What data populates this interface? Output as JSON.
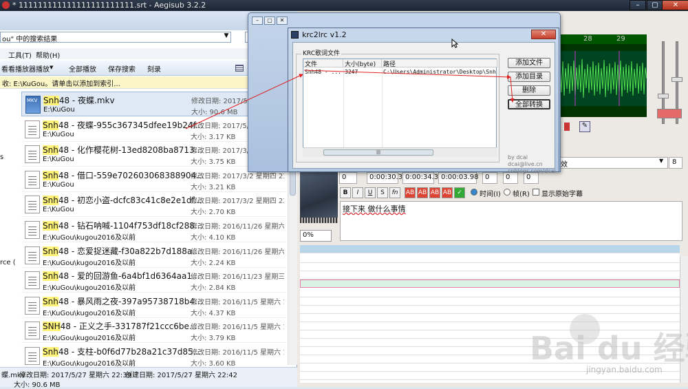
{
  "aegisub": {
    "title": "* 111111111111111111111111.srt - Aegisub 3.2.2",
    "ruler_ticks": [
      "28",
      "29"
    ],
    "time_fields": [
      "0",
      "0:00:30.35",
      "0:00:34.33",
      "0:00:03.98",
      "0",
      "0",
      "0"
    ],
    "format_buttons": [
      "B",
      "I",
      "U",
      "S",
      "fn",
      "AB",
      "AB",
      "AB",
      "AB"
    ],
    "radio_time": "时间(I)",
    "radio_frame": "帧(R)",
    "show_original": "显示原始字幕",
    "edit_text": "接下来 做什么事情",
    "zoom": "0%",
    "style_combo": "效",
    "layer": "8"
  },
  "explorer": {
    "path_text": "ou\" 中的搜索结果",
    "search_value": "snh",
    "menu": [
      "工具(T)",
      "帮助(H)"
    ],
    "toolbar": [
      "看看播放器播放",
      "全部播放",
      "保存搜索",
      "刻录"
    ],
    "info": "收: E:\\KuGou。请单击以添加到索引...",
    "nav_labels": [
      "s",
      "rce ("
    ],
    "files": [
      {
        "pre": "Snh",
        "name": "48 - 夜蝶.mkv",
        "dir": "E:\\KuGou",
        "date": "修改日期: 2017/5/27 星期六 22...",
        "size": "大小: 90.6 MB",
        "video": true
      },
      {
        "pre": "Snh",
        "name": "48 - 夜蝶-955c367345dfee19b24f...",
        "dir": "E:\\KuGou",
        "date": "修改日期: 2017/5/27 星期六 22...",
        "size": "大小: 3.17 KB",
        "video": false
      },
      {
        "pre": "Snh",
        "name": "48 - 化作樱花树-13ed8208ba8713...",
        "dir": "E:\\KuGou",
        "date": "修改日期: 2017/3/2 星期四 23:35",
        "size": "大小: 3.75 KB",
        "video": false
      },
      {
        "pre": "Snh",
        "name": "48 - 借口-559e702603068388904...",
        "dir": "E:\\KuGou",
        "date": "修改日期: 2017/3/2 星期四 23:34",
        "size": "大小: 3.21 KB",
        "video": false
      },
      {
        "pre": "Snh",
        "name": "48 - 初恋小盗-dcfc83c41c8e2e1df...",
        "dir": "E:\\KuGou",
        "date": "修改日期: 2017/3/2 星期四 23:34",
        "size": "大小: 2.70 KB",
        "video": false
      },
      {
        "pre": "Snh",
        "name": "48 - 钻石呐喊-1104f753df18cf288...",
        "dir": "E:\\KuGou\\kugou2016及以前",
        "date": "修改日期: 2016/11/26 星期六 1...",
        "size": "大小: 4.10 KB",
        "video": false
      },
      {
        "pre": "Snh",
        "name": "48 - 恋爱捉迷藏-f30a822b7d188a...",
        "dir": "E:\\KuGou\\kugou2016及以前",
        "date": "修改日期: 2016/11/26 星期六 1...",
        "size": "大小: 2.24 KB",
        "video": false
      },
      {
        "pre": "Snh",
        "name": "48 - 爱的回游鱼-6a4bf1d6364aa1...",
        "dir": "E:\\KuGou\\kugou2016及以前",
        "date": "修改日期: 2016/11/23 星期三 2...",
        "size": "大小: 2.84 KB",
        "video": false
      },
      {
        "pre": "Snh",
        "name": "48 - 暴风雨之夜-397a95738718b4...",
        "dir": "E:\\KuGou\\kugou2016及以前",
        "date": "修改日期: 2016/11/5 星期六 12...",
        "size": "大小: 4.37 KB",
        "video": false
      },
      {
        "pre": "SNH",
        "name": "48 - 正义之手-331787f21ccc6be...",
        "dir": "E:\\KuGou\\kugou2016及以前",
        "date": "修改日期: 2016/11/5 星期六 12...",
        "size": "大小: 3.79 KB",
        "video": false
      },
      {
        "pre": "Snh",
        "name": "48 - 支柱-b0f6d77b28a21c37d85...",
        "dir": "E:\\KuGou\\kugou2016及以前",
        "date": "修改日期: 2016/11/5 星期六 12...",
        "size": "大小: 3.60 KB",
        "video": false
      }
    ],
    "status_name": "蝶.mkv",
    "status_modified": "修改日期: 2017/5/27 星期六 22:39",
    "status_created": "创建日期: 2017/5/27 星期六 22:42",
    "status_size": "大小: 90.6 MB"
  },
  "krc": {
    "title": "krc2lrc v1.2",
    "close": "✕",
    "group_label": "KRC歌词文件",
    "col_file": "文件",
    "col_size": "大小(byte)",
    "col_path": "路径",
    "row_file": "Snh48 - ...",
    "row_size": "3247",
    "row_path": "C:\\Users\\Administrator\\Desktop\\Snh48",
    "scroll_grip": "|||",
    "btn_add_file": "添加文件",
    "btn_add_dir": "添加目录",
    "btn_delete": "删除",
    "btn_convert_all": "全部转换",
    "credit1": "by dcai",
    "credit2": "dcai@live.cn",
    "credit3": "cnblogs.com/dcai"
  },
  "watermark": {
    "logo": "Bai du 经验",
    "url": "jingyan.baidu.com"
  },
  "colors": {
    "annotation_arrow": "#e02020",
    "highlight": "#fff37a"
  }
}
